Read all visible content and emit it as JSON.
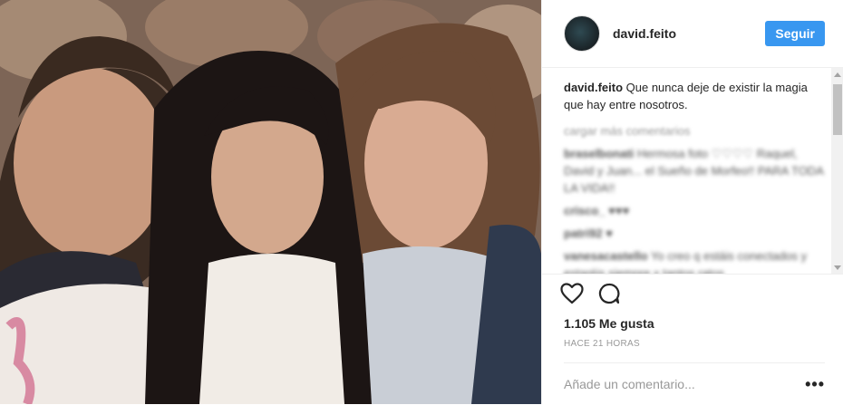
{
  "header": {
    "username": "david.feito",
    "follow_label": "Seguir"
  },
  "caption": {
    "username": "david.feito",
    "text": "Que nunca deje de existir la magia que hay entre nosotros."
  },
  "comments": {
    "load_more": "cargar más comentarios",
    "items": [
      {
        "user": "braselbonati",
        "text": "Hermosa foto ♡♡♡♡ Raquel, David y Juan... el Sueño de Morfeo!! PARA TODA LA VIDA!!"
      },
      {
        "user": "crisco_",
        "text": "♥♥♥"
      },
      {
        "user": "patri92",
        "text": "♥"
      },
      {
        "user": "vanesacastello",
        "text": "Yo creo q estáis conectados y estaréis siempre x tantos ratos"
      }
    ]
  },
  "stats": {
    "likes": "1.105 Me gusta",
    "time": "HACE 21 HORAS"
  },
  "add_comment": {
    "placeholder": "Añade un comentario..."
  },
  "more_options": "•••",
  "icons": {
    "like": "heart-icon",
    "comment": "comment-bubble-icon",
    "options": "more-options-icon"
  },
  "colors": {
    "accent": "#3897f0",
    "muted": "#999999",
    "divider": "#efefef"
  }
}
